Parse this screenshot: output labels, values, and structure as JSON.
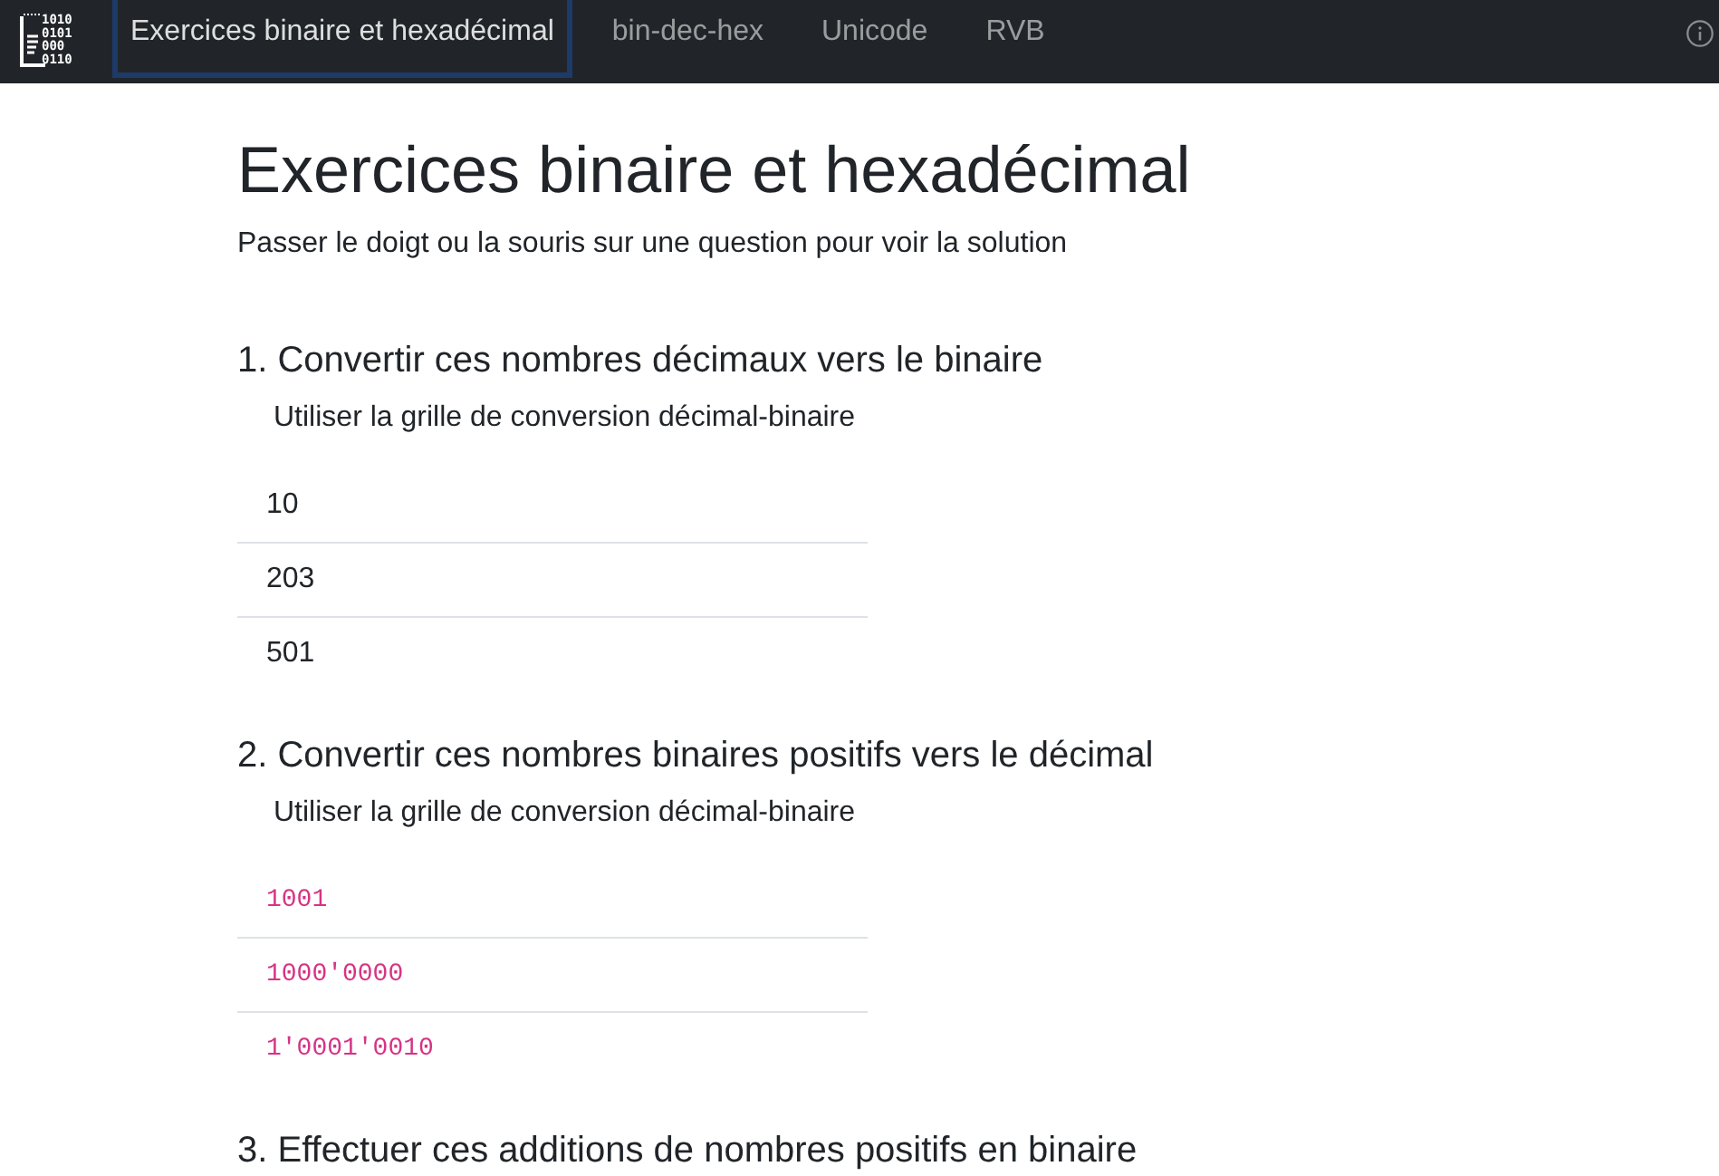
{
  "navbar": {
    "logo": {
      "lines": [
        "1010",
        "0101",
        "000",
        "0110"
      ]
    },
    "tabs": [
      {
        "label": "Exercices binaire et hexadécimal",
        "selected": true
      },
      {
        "label": "bin-dec-hex",
        "selected": false
      },
      {
        "label": "Unicode",
        "selected": false
      },
      {
        "label": "RVB",
        "selected": false
      }
    ]
  },
  "page": {
    "title": "Exercices binaire et hexadécimal",
    "subtitle": "Passer le doigt ou la souris sur une question pour voir la solution"
  },
  "sections": [
    {
      "heading": "1. Convertir ces nombres décimaux vers le binaire",
      "instruction": "Utiliser la grille de conversion décimal-binaire",
      "kind": "plain",
      "items": [
        "10",
        "203",
        "501"
      ]
    },
    {
      "heading": "2. Convertir ces nombres binaires positifs vers le décimal",
      "instruction": "Utiliser la grille de conversion décimal-binaire",
      "kind": "code",
      "items": [
        "1001",
        "1000'0000",
        "1'0001'0010"
      ]
    },
    {
      "heading": "3. Effectuer ces additions de nombres positifs en binaire"
    }
  ]
}
